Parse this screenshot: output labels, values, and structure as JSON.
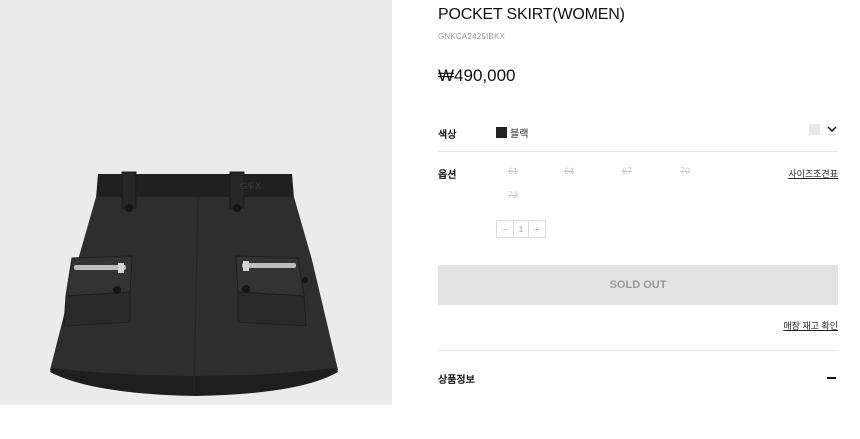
{
  "product": {
    "title": "POCKET SKIRT(WOMEN)",
    "code": "GNKCA2425IBKX",
    "price": "₩490,000"
  },
  "color": {
    "label": "색상",
    "selected_name": "블랙",
    "selected_color": "#222222",
    "dropdown_chip_color": "#e8e8e8",
    "dropdown_icon": "chevron-down-icon"
  },
  "options": {
    "label": "옵션",
    "size_guide": "사이즈조견표",
    "sizes": [
      "61",
      "64",
      "67",
      "70",
      "73"
    ],
    "sizes_available": false,
    "quantity": {
      "minus": "−",
      "value": "1",
      "plus": "+"
    }
  },
  "actions": {
    "sold_out": "SOLD OUT",
    "stock_check": "매장 재고 확인"
  },
  "details": {
    "label": "상품정보",
    "toggle_icon": "minus-icon"
  },
  "colors": {
    "gallery_bg": "#ebebeb",
    "soldout_bg": "#e3e3e3",
    "soldout_text": "#9a9a9a",
    "disabled_text": "#c9c9c9"
  }
}
